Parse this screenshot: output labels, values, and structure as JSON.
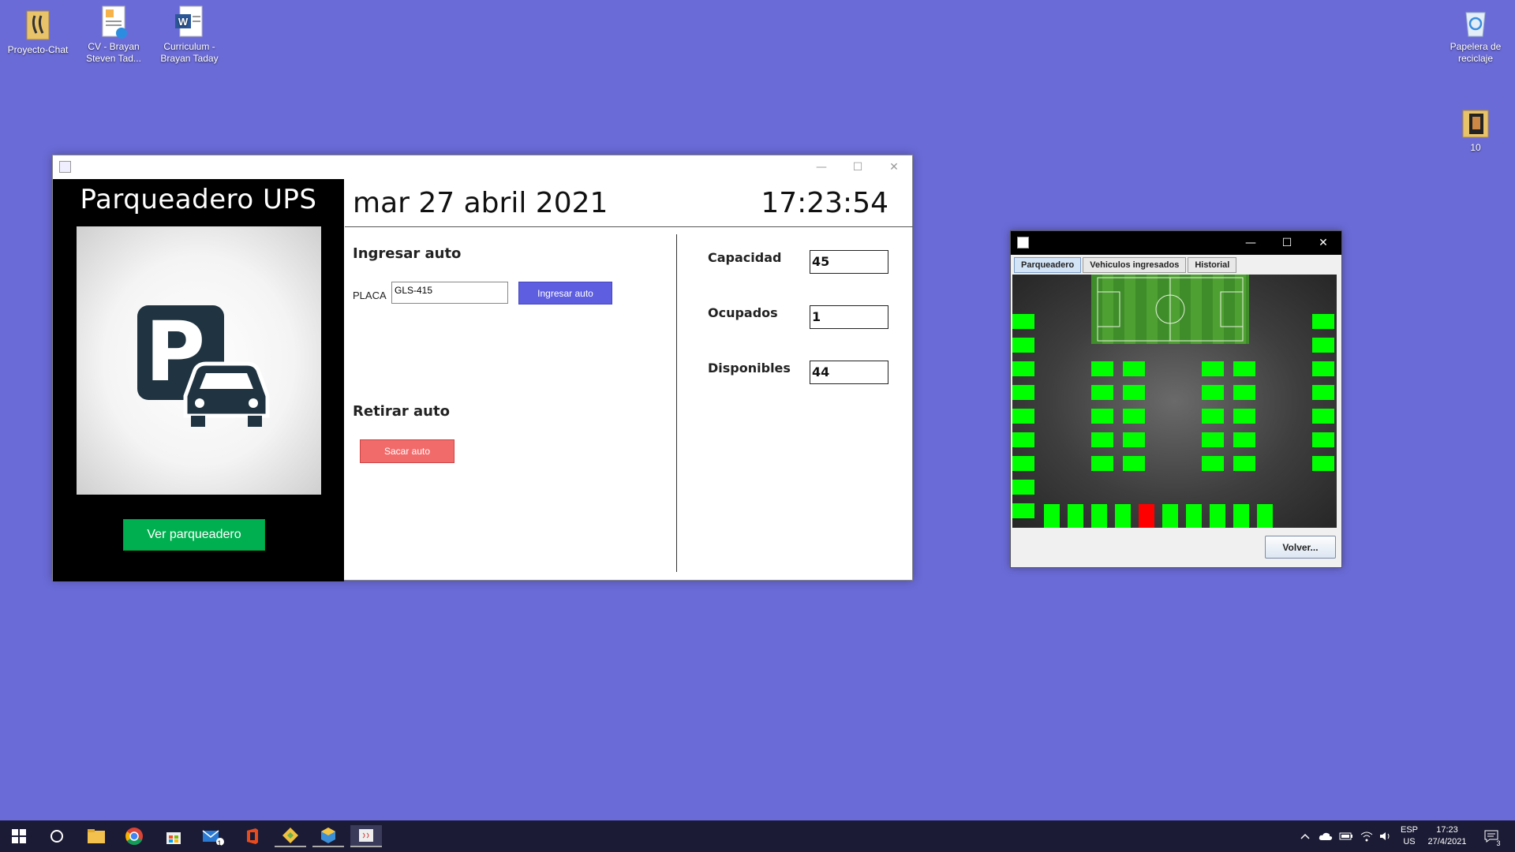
{
  "desktop": {
    "icons": [
      {
        "label": "Proyecto-Chat"
      },
      {
        "label": "CV - Brayan Steven Tad..."
      },
      {
        "label": "Curriculum - Brayan Taday"
      },
      {
        "label": "Papelera de reciclaje"
      },
      {
        "label": "10"
      }
    ]
  },
  "main_window": {
    "brand_title": "Parqueadero UPS",
    "date": "mar 27 abril 2021",
    "time": "17:23:54",
    "ver_parqueadero_label": "Ver parqueadero",
    "ingresar": {
      "title": "Ingresar auto",
      "placa_label": "PLACA",
      "placa_value": "GLS-415",
      "button_label": "Ingresar auto"
    },
    "retirar": {
      "title": "Retirar auto",
      "button_label": "Sacar auto"
    },
    "stats": {
      "capacidad_label": "Capacidad",
      "capacidad_value": "45",
      "ocupados_label": "Ocupados",
      "ocupados_value": "1",
      "disponibles_label": "Disponibles",
      "disponibles_value": "44"
    }
  },
  "parking_window": {
    "tabs": [
      {
        "label": "Parqueadero",
        "active": true
      },
      {
        "label": "Vehiculos ingresados",
        "active": false
      },
      {
        "label": "Historial",
        "active": false
      }
    ],
    "volver_label": "Volver...",
    "free_color": "#00ff00",
    "occupied_color": "#ff0000",
    "bottom_row": [
      "free",
      "free",
      "free",
      "free",
      "occupied",
      "free",
      "free",
      "free",
      "free",
      "free"
    ]
  },
  "taskbar": {
    "lang_top": "ESP",
    "lang_bottom": "US",
    "clock_time": "17:23",
    "clock_date": "27/4/2021",
    "notification_count": "3",
    "mail_badge": "1"
  }
}
